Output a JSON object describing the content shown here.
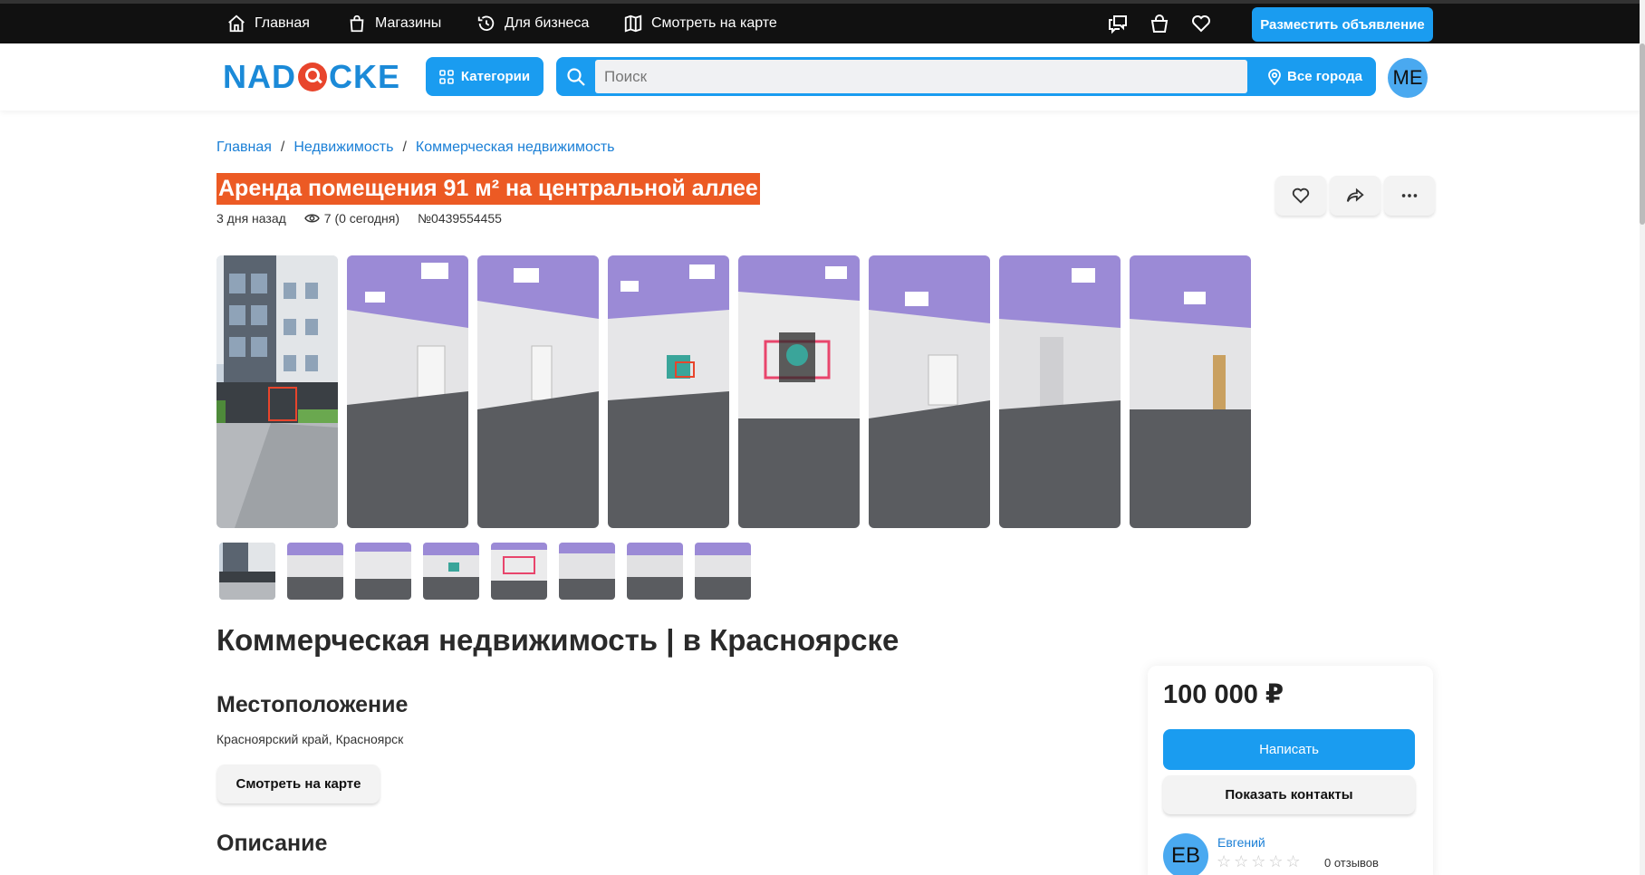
{
  "topnav": {
    "items": [
      {
        "label": "Главная",
        "icon": "home-icon"
      },
      {
        "label": "Магазины",
        "icon": "shopping-bag-icon"
      },
      {
        "label": "Для бизнеса",
        "icon": "history-icon"
      },
      {
        "label": "Смотреть на карте",
        "icon": "map-icon"
      }
    ],
    "post_button": "Разместить объявление",
    "icons": [
      "chat-icon",
      "cart-icon",
      "heart-icon"
    ]
  },
  "header": {
    "logo": {
      "before": "NAD",
      "after": "CKE"
    },
    "categories_label": "Категории",
    "search_placeholder": "Поиск",
    "search_value": "",
    "city_label": "Все города",
    "user_initials": "ME"
  },
  "breadcrumbs": [
    "Главная",
    "Недвижимость",
    "Коммерческая недвижимость"
  ],
  "listing": {
    "title": "Аренда помещения 91 м² на центральной аллее",
    "posted": "3 дня назад",
    "views": "7 (0 сегодня)",
    "number": "№0439554455",
    "heading": "Коммерческая недвижимость | в Красноярске",
    "location_title": "Местоположение",
    "location": "Красноярский край, Красноярск",
    "map_button": "Смотреть на карте",
    "description_title": "Описание"
  },
  "gallery": {
    "photos": [
      "building-exterior",
      "interior-ceiling-lights",
      "interior-window",
      "interior-graffiti",
      "interior-graffiti-wall",
      "interior-window-2",
      "interior-doorway",
      "interior-corridor"
    ]
  },
  "price_card": {
    "price": "100 000 ₽",
    "write_button": "Написать",
    "contacts_button": "Показать контакты",
    "seller_initials": "EB",
    "seller_name": "Евгений",
    "stars": "☆☆☆☆☆",
    "reviews": "0 отзывов"
  },
  "colors": {
    "accent": "#1a9cf0",
    "title_highlight": "#ec5a24",
    "topbar": "#111111",
    "ceiling": "#9b8ad6",
    "floor": "#5a5c60"
  }
}
